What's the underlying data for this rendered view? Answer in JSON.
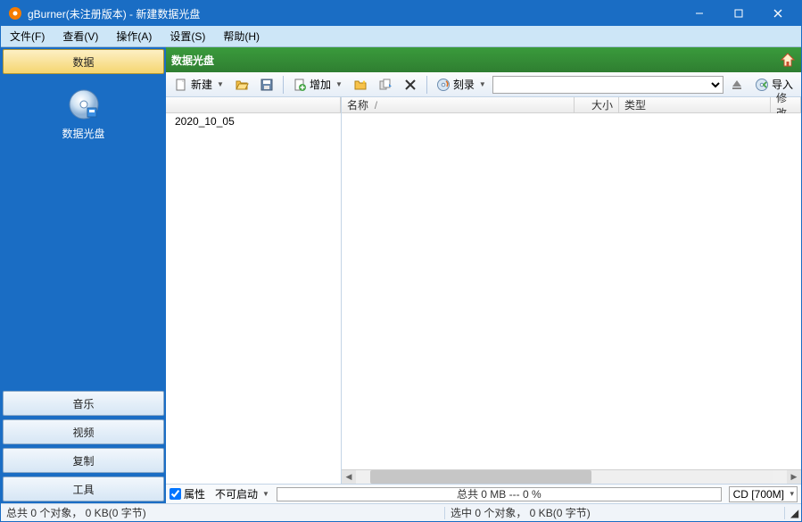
{
  "titlebar": {
    "title": "gBurner(未注册版本) - 新建数据光盘"
  },
  "menus": {
    "file": "文件(F)",
    "view": "查看(V)",
    "action": "操作(A)",
    "settings": "设置(S)",
    "help": "帮助(H)"
  },
  "sidebar": {
    "active": "数据",
    "panel_label": "数据光盘",
    "tabs": {
      "music": "音乐",
      "video": "视频",
      "copy": "复制",
      "tools": "工具"
    }
  },
  "header": {
    "title": "数据光盘"
  },
  "toolbar": {
    "new": "新建",
    "add": "增加",
    "burn": "刻录",
    "import": "导入"
  },
  "tree": {
    "root": "2020_10_05"
  },
  "list": {
    "cols": {
      "name": "名称",
      "size": "大小",
      "type": "类型",
      "modified": "修改"
    },
    "sort_marker": "/"
  },
  "footer": {
    "properties": "属性",
    "not_bootable": "不可启动",
    "progress": "总共 0 MB --- 0 %",
    "media": "CD [700M]"
  },
  "status": {
    "left": "总共 0 个对象， 0 KB(0 字节)",
    "right": "选中 0 个对象， 0 KB(0 字节)"
  }
}
